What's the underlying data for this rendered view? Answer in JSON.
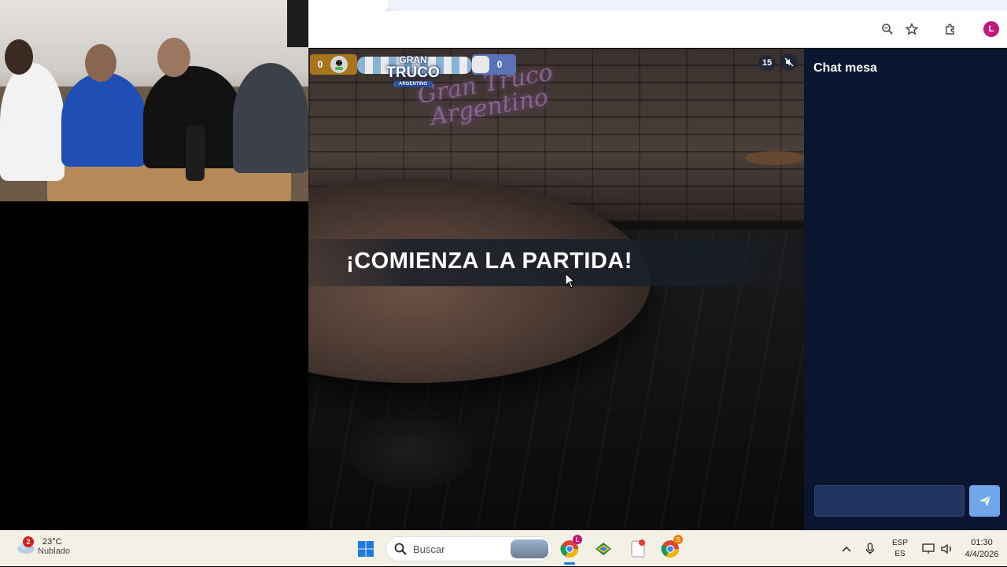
{
  "browser": {
    "toolbar_icons": [
      "zoom-icon",
      "star-icon",
      "extensions-icon"
    ],
    "profile_initial": "L",
    "profile_color": "#c2187a"
  },
  "game": {
    "score_left": "0",
    "score_right": "0",
    "logo_line1": "GRAN",
    "logo_line2": "TRUCO",
    "logo_line3": "ARGENTINO",
    "neon_line1": "Gran Truco",
    "neon_line2": "Argentino",
    "round_number": "15",
    "banner": "¡COMIENZA LA PARTIDA!"
  },
  "chat": {
    "title": "Chat mesa",
    "input_value": "",
    "send_color": "#6fa6ea"
  },
  "taskbar": {
    "weather_badge": "2",
    "weather_temp": "23°C",
    "weather_condition": "Nublado",
    "search_placeholder": "Buscar",
    "chrome_badge_1": "L",
    "chrome_badge_2": "S",
    "lang_line1": "ESP",
    "lang_line2": "ES",
    "time": "01:30",
    "date": "4/4/2026"
  }
}
